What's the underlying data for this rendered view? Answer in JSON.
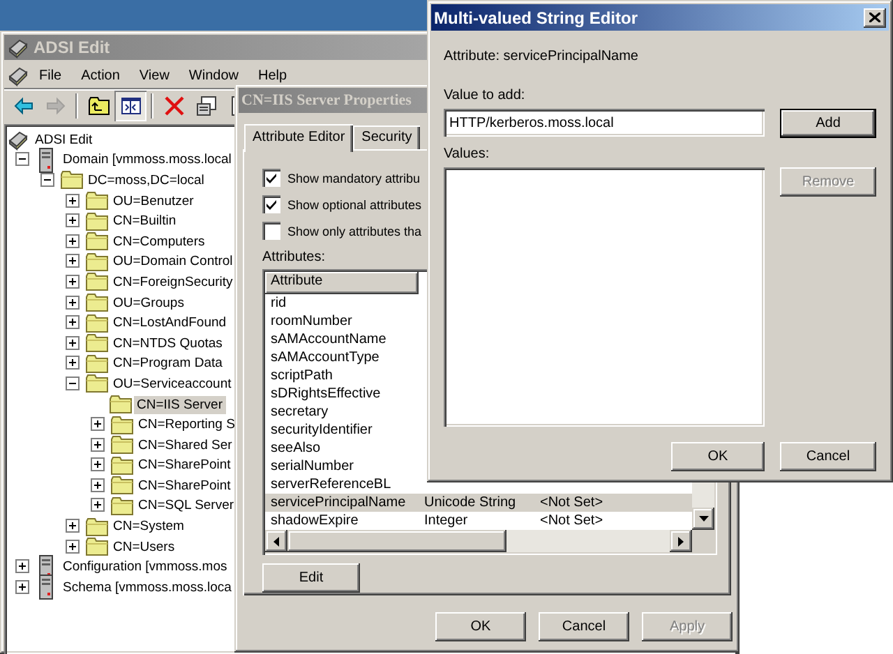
{
  "main_window": {
    "title": "ADSI Edit",
    "active": false,
    "menu": [
      {
        "label": "File"
      },
      {
        "label": "Action"
      },
      {
        "label": "View"
      },
      {
        "label": "Window"
      },
      {
        "label": "Help"
      }
    ],
    "toolbar": [
      {
        "disabled": false,
        "pressed": false
      },
      {
        "disabled": true,
        "pressed": false
      },
      {
        "disabled": false,
        "pressed": false
      },
      {
        "disabled": false,
        "pressed": true
      },
      {
        "disabled": false,
        "pressed": false
      },
      {
        "disabled": false,
        "pressed": false
      },
      {
        "disabled": false,
        "pressed": false
      }
    ],
    "tree": [
      {
        "label": "ADSI Edit",
        "kind": "root",
        "selected": false,
        "children": [
          {
            "label": "Domain [vmmoss.moss.local",
            "kind": "server",
            "expanded": true,
            "selected": false,
            "children": [
              {
                "label": "DC=moss,DC=local",
                "kind": "folder",
                "expanded": true,
                "selected": false,
                "children": [
                  {
                    "label": "OU=Benutzer",
                    "kind": "folder",
                    "expanded": false,
                    "selected": false
                  },
                  {
                    "label": "CN=Builtin",
                    "kind": "folder",
                    "expanded": false,
                    "selected": false
                  },
                  {
                    "label": "CN=Computers",
                    "kind": "folder",
                    "expanded": false,
                    "selected": false
                  },
                  {
                    "label": "OU=Domain Control",
                    "kind": "folder",
                    "expanded": false,
                    "selected": false
                  },
                  {
                    "label": "CN=ForeignSecurity",
                    "kind": "folder",
                    "expanded": false,
                    "selected": false
                  },
                  {
                    "label": "OU=Groups",
                    "kind": "folder",
                    "expanded": false,
                    "selected": false
                  },
                  {
                    "label": "CN=LostAndFound",
                    "kind": "folder",
                    "expanded": false,
                    "selected": false
                  },
                  {
                    "label": "CN=NTDS Quotas",
                    "kind": "folder",
                    "expanded": false,
                    "selected": false
                  },
                  {
                    "label": "CN=Program Data",
                    "kind": "folder",
                    "expanded": false,
                    "selected": false
                  },
                  {
                    "label": "OU=Serviceaccount",
                    "kind": "folder",
                    "expanded": true,
                    "selected": false,
                    "children": [
                      {
                        "label": "CN=IIS Server",
                        "kind": "folder",
                        "selected": true
                      },
                      {
                        "label": "CN=Reporting S",
                        "kind": "folder",
                        "expanded": false,
                        "selected": false
                      },
                      {
                        "label": "CN=Shared Ser",
                        "kind": "folder",
                        "expanded": false,
                        "selected": false
                      },
                      {
                        "label": "CN=SharePoint",
                        "kind": "folder",
                        "expanded": false,
                        "selected": false
                      },
                      {
                        "label": "CN=SharePoint",
                        "kind": "folder",
                        "expanded": false,
                        "selected": false
                      },
                      {
                        "label": "CN=SQL Server",
                        "kind": "folder",
                        "expanded": false,
                        "selected": false
                      }
                    ]
                  },
                  {
                    "label": "CN=System",
                    "kind": "folder",
                    "expanded": false,
                    "selected": false
                  },
                  {
                    "label": "CN=Users",
                    "kind": "folder",
                    "expanded": false,
                    "selected": false
                  }
                ]
              }
            ]
          },
          {
            "label": "Configuration [vmmoss.mos",
            "kind": "server",
            "expanded": false,
            "selected": false
          },
          {
            "label": "Schema [vmmoss.moss.loca",
            "kind": "server",
            "expanded": false,
            "selected": false
          }
        ]
      }
    ]
  },
  "properties_dialog": {
    "title": "CN=IIS Server Properties",
    "active": false,
    "tabs": [
      {
        "label": "Attribute Editor",
        "selected": true
      },
      {
        "label": "Security",
        "selected": false
      }
    ],
    "checkboxes": [
      {
        "label": "Show mandatory attribu",
        "checked": true
      },
      {
        "label": "Show optional attributes",
        "checked": true
      },
      {
        "label": "Show only attributes tha",
        "checked": false
      }
    ],
    "attributes_label": "Attributes:",
    "columns": [
      "Attribute"
    ],
    "rows": [
      {
        "cells": [
          "rid"
        ],
        "selected": false
      },
      {
        "cells": [
          "roomNumber"
        ],
        "selected": false
      },
      {
        "cells": [
          "sAMAccountName"
        ],
        "selected": false
      },
      {
        "cells": [
          "sAMAccountType"
        ],
        "selected": false
      },
      {
        "cells": [
          "scriptPath"
        ],
        "selected": false
      },
      {
        "cells": [
          "sDRightsEffective"
        ],
        "selected": false
      },
      {
        "cells": [
          "secretary"
        ],
        "selected": false
      },
      {
        "cells": [
          "securityIdentifier"
        ],
        "selected": false
      },
      {
        "cells": [
          "seeAlso"
        ],
        "selected": false
      },
      {
        "cells": [
          "serialNumber"
        ],
        "selected": false
      },
      {
        "cells": [
          "serverReferenceBL"
        ],
        "selected": false
      },
      {
        "cells": [
          "servicePrincipalName",
          "Unicode String",
          "<Not Set>"
        ],
        "selected": true
      },
      {
        "cells": [
          "shadowExpire",
          "Integer",
          "<Not Set>"
        ],
        "selected": false
      }
    ],
    "edit_button": "Edit",
    "buttons": [
      {
        "label": "OK",
        "disabled": false
      },
      {
        "label": "Cancel",
        "disabled": false
      },
      {
        "label": "Apply",
        "disabled": true
      }
    ]
  },
  "multi_value_editor": {
    "title": "Multi-valued String Editor",
    "active": true,
    "attribute_label": "Attribute: servicePrincipalName",
    "value_label": "Value to add:",
    "value": "HTTP/kerberos.moss.local",
    "add_button": {
      "label": "Add",
      "default": true,
      "disabled": false
    },
    "values_label": "Values:",
    "remove_button": {
      "label": "Remove",
      "default": false,
      "disabled": true
    },
    "buttons": [
      {
        "label": "OK",
        "disabled": false
      },
      {
        "label": "Cancel",
        "disabled": false
      }
    ]
  }
}
